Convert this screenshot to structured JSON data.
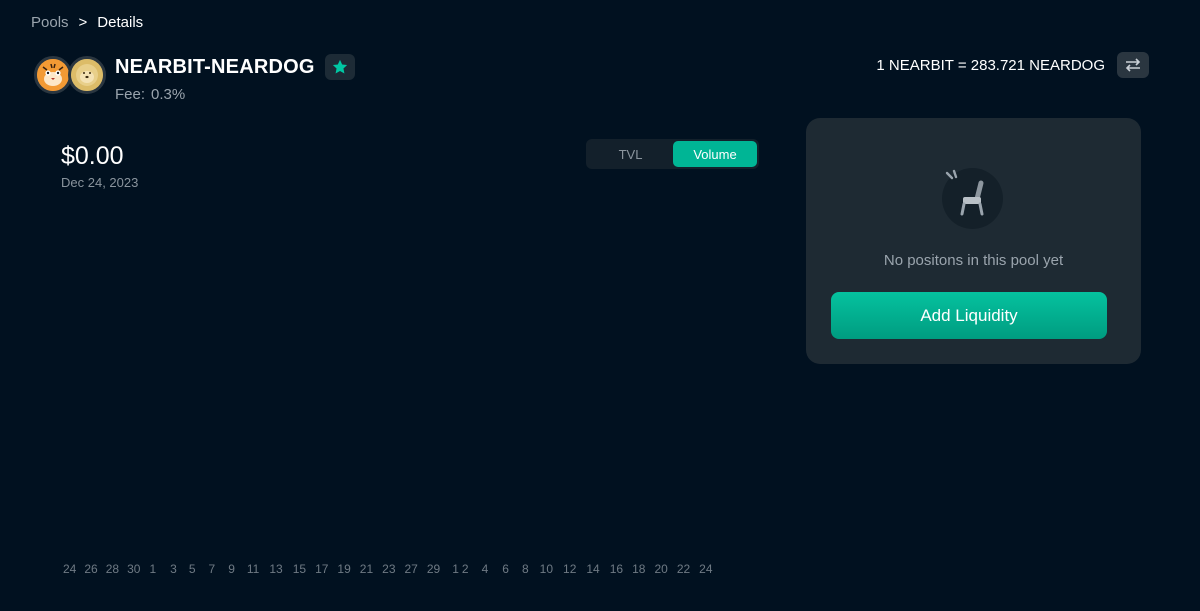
{
  "breadcrumb": {
    "root": "Pools",
    "separator": ">",
    "current": "Details"
  },
  "pool": {
    "name": "NEARBIT-NEARDOG",
    "fee_label": "Fee:",
    "fee_value": "0.3%",
    "token_a_icon": "tiger-token-icon",
    "token_b_icon": "doge-token-icon",
    "favorite_icon": "star-icon"
  },
  "rate": {
    "text": "1 NEARBIT = 283.721 NEARDOG",
    "swap_icon": "swap-arrows-icon"
  },
  "chart_summary": {
    "value": "$0.00",
    "date": "Dec 24, 2023"
  },
  "chart_toggle": {
    "options": [
      "TVL",
      "Volume"
    ],
    "selected": "Volume"
  },
  "chart_data": {
    "type": "bar",
    "categories": [
      "24",
      "26",
      "28",
      "30",
      "1",
      "3",
      "5",
      "7",
      "9",
      "11",
      "13",
      "15",
      "17",
      "19",
      "21",
      "23",
      "27",
      "29",
      "1",
      "2",
      "4",
      "6",
      "8",
      "10",
      "12",
      "14",
      "16",
      "18",
      "20",
      "22",
      "24"
    ],
    "values": [],
    "title": "",
    "xlabel": "",
    "ylabel": ""
  },
  "positions_card": {
    "empty_icon": "chair-icon",
    "empty_text": "No positons in this pool yet",
    "add_button_label": "Add Liquidity"
  },
  "colors": {
    "background": "#011120",
    "accent": "#00b595",
    "card": "#1e2a33"
  }
}
